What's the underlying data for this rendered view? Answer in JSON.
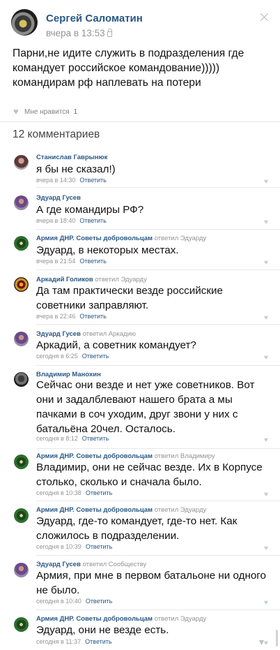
{
  "post": {
    "author": "Сергей Саломатин",
    "date": "вчера в 13:53",
    "text": "Парни,не идите служить в подразделения где командует российское командование))))) командирам рф наплевать на потери",
    "likes_label": "Мне нравится",
    "likes_count": "1"
  },
  "comments_header": "12 комментариев",
  "comments": [
    {
      "author": "Станислав Гаврынюк",
      "reply_to": "",
      "text": "я бы не сказал!)",
      "time": "вчера в 14:30",
      "reply_label": "Ответить"
    },
    {
      "author": "Эдуард Гусев",
      "reply_to": "",
      "text": "А где командиры РФ?",
      "time": "вчера в 18:40",
      "reply_label": "Ответить"
    },
    {
      "author": "Армия ДНР. Советы добровольцам",
      "reply_to": "ответил Эдуарду",
      "text": "Эдуард, в некоторых местах.",
      "time": "вчера в 21:54",
      "reply_label": "Ответить"
    },
    {
      "author": "Аркадий Голиков",
      "reply_to": "ответил Эдуарду",
      "text": "Да там практически везде российские советники заправляют.",
      "time": "вчера в 22:46",
      "reply_label": "Ответить"
    },
    {
      "author": "Эдуард Гусев",
      "reply_to": "ответил Аркадию",
      "text": "Аркадий, а советник командует?",
      "time": "сегодня в 6:25",
      "reply_label": "Ответить"
    },
    {
      "author": "Владимир Манохин",
      "reply_to": "",
      "text": "Сейчас они везде и нет уже советников. Вот они и задалблевают нашего брата а мы пачками в соч уходим, друг звони у них с батальёна 20чел. Осталось.",
      "time": "сегодня в 8:12",
      "reply_label": "Ответить"
    },
    {
      "author": "Армия ДНР. Советы добровольцам",
      "reply_to": "ответил Владимиру",
      "text": "Владимир, они не сейчас везде. Их в Корпусе столько, сколько и сначала было.",
      "time": "сегодня в 10:38",
      "reply_label": "Ответить"
    },
    {
      "author": "Армия ДНР. Советы добровольцам",
      "reply_to": "ответил Эдуарду",
      "text": "Эдуард, где-то командует, где-то нет. Как сложилось в подразделении.",
      "time": "сегодня в 10:39",
      "reply_label": "Ответить"
    },
    {
      "author": "Эдуард Гусев",
      "reply_to": "ответил Сообществу",
      "text": "Армия, при мне в первом батальоне ни одного не было.",
      "time": "сегодня в 10:40",
      "reply_label": "Ответить"
    },
    {
      "author": "Армия ДНР. Советы добровольцам",
      "reply_to": "ответил Эдуарду",
      "text": "Эдуард, они не везде есть.",
      "time": "сегодня в 11:37",
      "reply_label": "Ответить"
    }
  ],
  "icons": {
    "more": "close-icon",
    "like": "heart-icon",
    "private": "lock-icon"
  },
  "colors": {
    "link": "#2a5885",
    "muted": "#939393",
    "divider": "#e7e8ec"
  }
}
